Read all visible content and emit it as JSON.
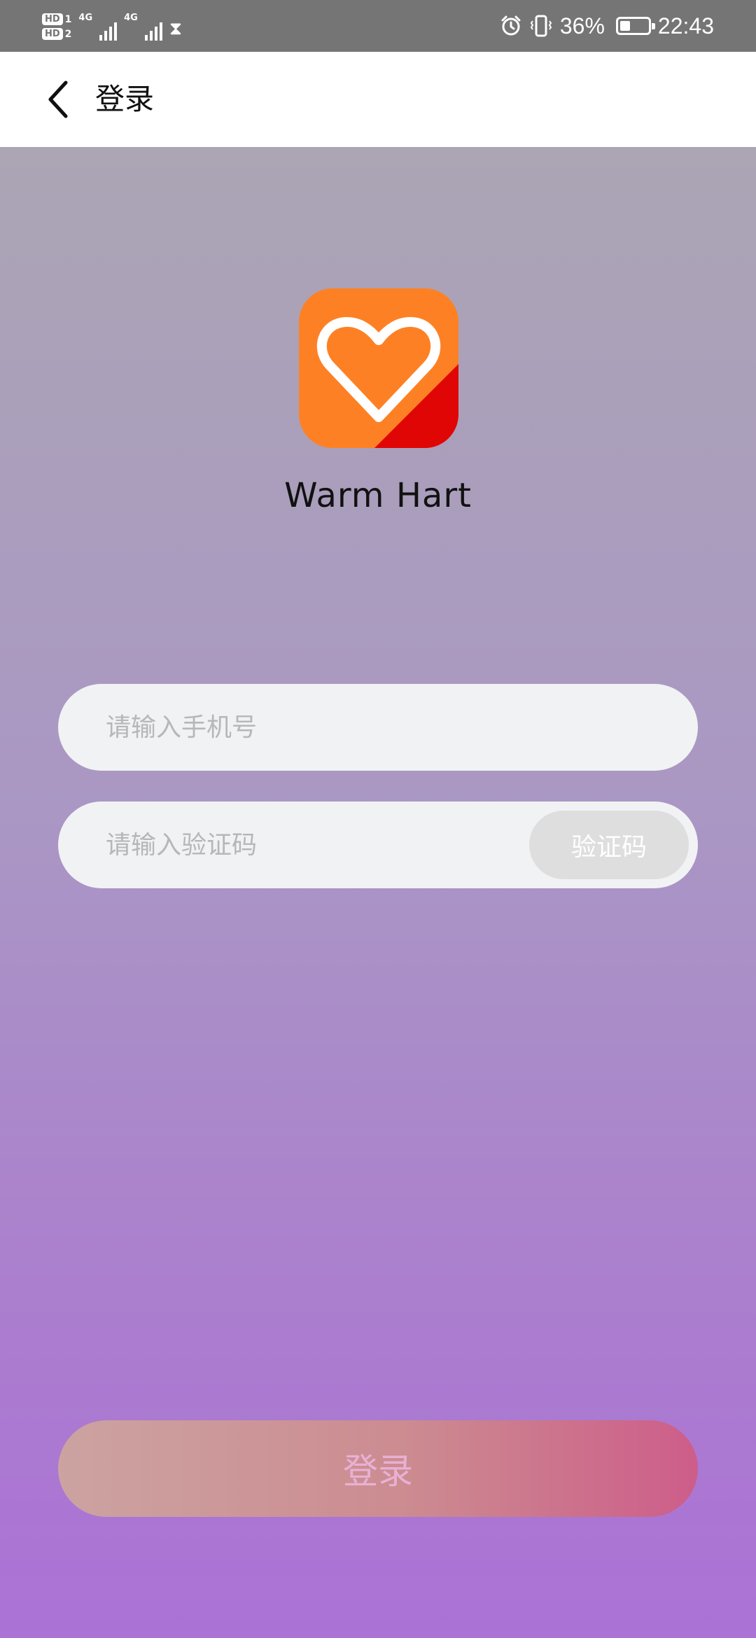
{
  "status_bar": {
    "hd1_label": "HD",
    "hd1_sub": "1",
    "hd2_label": "HD",
    "hd2_sub": "2",
    "network_1": "4G",
    "network_2": "4G",
    "battery_percent": "36%",
    "battery_level": 0.36,
    "time": "22:43",
    "icons": [
      "signal-icon",
      "hourglass-icon",
      "alarm-icon",
      "vibrate-icon",
      "battery-icon"
    ]
  },
  "header": {
    "back_icon": "chevron-left-icon",
    "title": "登录"
  },
  "app": {
    "name": "Warm Hart",
    "logo_icon": "heart-icon",
    "logo_colors": {
      "primary": "#fd8124",
      "accent": "#e10606",
      "heart": "#ffffff"
    }
  },
  "form": {
    "phone_placeholder": "请输入手机号",
    "code_placeholder": "请输入验证码",
    "get_code_label": "验证码",
    "submit_label": "登录"
  },
  "colors": {
    "status_bar": "#757575",
    "background_top": "#aba5b4",
    "background_bottom": "#ab72d6",
    "input_background": "#f1f2f4",
    "code_button": "#dedede",
    "login_gradient_start": "#cca3a1",
    "login_gradient_end": "#cd5d8a"
  }
}
